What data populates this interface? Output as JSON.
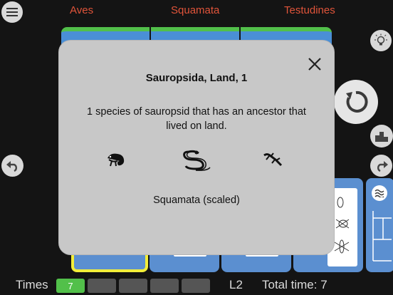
{
  "header": {
    "categories": [
      "Aves",
      "Squamata",
      "Testudines"
    ]
  },
  "modal": {
    "title": "Sauropsida, Land, 1",
    "description": "1 species of sauropsid that has an ancestor that lived on land.",
    "caption": "Squamata (scaled)",
    "icons": [
      "chameleon-icon",
      "snake-icon",
      "lizard-icon"
    ]
  },
  "footer": {
    "times_label": "Times",
    "times_value": "7",
    "level": "L2",
    "total_time": "Total time: 7"
  },
  "colors": {
    "background": "#141414",
    "category_text": "#e0543a",
    "card_blue": "#5b8fd0",
    "accent_green": "#52c04a",
    "selection_yellow": "#f2ee3a",
    "modal_bg": "#c8c8c8"
  },
  "icons": {
    "menu": "menu-icon",
    "undo": "undo-icon",
    "redo": "redo-icon",
    "restart": "restart-icon",
    "hint": "lightbulb-icon",
    "ranking": "podium-icon",
    "water": "water-icon"
  }
}
